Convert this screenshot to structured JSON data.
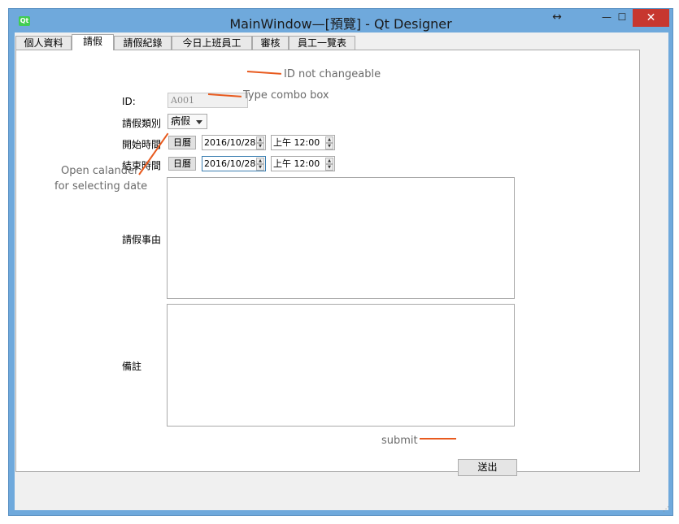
{
  "window": {
    "title": "MainWindow—[預覽] - Qt Designer",
    "app_icon_text": "Qt",
    "buttons": {
      "resize": "↔",
      "minimize": "—",
      "maximize": "☐",
      "close": "✕"
    }
  },
  "tabs": [
    {
      "label": "個人資料"
    },
    {
      "label": "請假"
    },
    {
      "label": "請假紀錄"
    },
    {
      "label": "今日上班員工"
    },
    {
      "label": "審核"
    },
    {
      "label": "員工一覽表"
    }
  ],
  "form": {
    "id_label": "ID:",
    "id_value": "A001",
    "leave_type_label": "請假類別",
    "leave_type_value": "病假",
    "start_label": "開始時間",
    "end_label": "結束時間",
    "calendar_button": "日曆",
    "start_date": "2016/10/28",
    "start_time": "上午 12:00",
    "end_date": "2016/10/28",
    "end_time": "上午 12:00",
    "reason_label": "請假事由",
    "remark_label": "備註",
    "submit_label": "送出"
  },
  "annotations": {
    "id": "ID not changeable",
    "combo": "Type combo box",
    "calendar_line1": "Open calander",
    "calendar_line2": "for selecting date",
    "submit": "submit"
  },
  "colors": {
    "annotation_line": "#e85a1e",
    "window_frame": "#6fa9dc",
    "close_button": "#c7372f"
  }
}
